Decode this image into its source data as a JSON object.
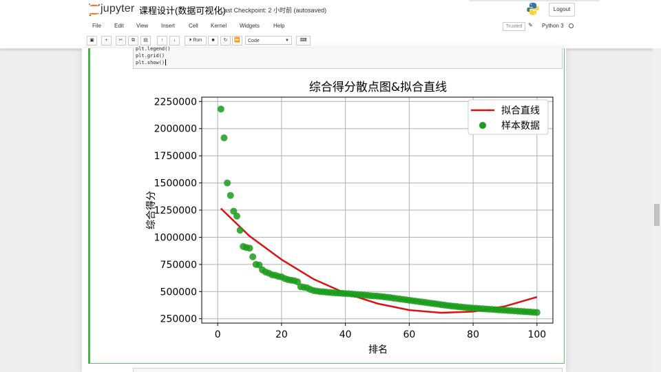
{
  "header": {
    "logo_text": "jupyter",
    "notebook_title": "课程设计(数据可视化)",
    "checkpoint": "Last Checkpoint: 2 小时前  (autosaved)",
    "logout_label": "Logout"
  },
  "menubar": {
    "items": [
      "File",
      "Edit",
      "View",
      "Insert",
      "Cell",
      "Kernel",
      "Widgets",
      "Help"
    ],
    "trusted_label": "Trusted",
    "kernel_name": "Python 3"
  },
  "toolbar": {
    "run_label": "Run",
    "cell_type": "Code"
  },
  "code": {
    "lines": [
      "plt.legend()",
      "plt.grid()",
      "plt.show()"
    ]
  },
  "colors": {
    "scatter": "#1a9b1a",
    "fit_line": "#dd1111",
    "cell_selected": "#66bb6a"
  },
  "chart_data": {
    "type": "scatter",
    "title": "综合得分散点图&拟合直线",
    "xlabel": "排名",
    "ylabel": "综合得分",
    "xlim": [
      -5,
      105
    ],
    "ylim": [
      210000,
      2290000
    ],
    "xticks": [
      0,
      20,
      40,
      60,
      80,
      100
    ],
    "yticks": [
      250000,
      500000,
      750000,
      1000000,
      1250000,
      1500000,
      1750000,
      2000000,
      2250000
    ],
    "grid": true,
    "legend_position": "top-right",
    "series": [
      {
        "name": "拟合直线",
        "kind": "line",
        "x": [
          1,
          10,
          20,
          30,
          40,
          50,
          60,
          70,
          80,
          90,
          100
        ],
        "y": [
          1265000,
          1010000,
          795000,
          615000,
          485000,
          390000,
          330000,
          305000,
          315000,
          365000,
          450000
        ]
      },
      {
        "name": "样本数据",
        "kind": "scatter",
        "x": [
          1,
          2,
          3,
          4,
          5,
          6,
          7,
          8,
          9,
          10,
          11,
          12,
          13,
          14,
          15,
          16,
          17,
          18,
          19,
          20,
          21,
          22,
          23,
          24,
          25,
          26,
          27,
          28,
          29,
          30,
          31,
          32,
          33,
          34,
          35,
          36,
          37,
          38,
          39,
          40,
          41,
          42,
          43,
          44,
          45,
          46,
          47,
          48,
          49,
          50,
          51,
          52,
          53,
          54,
          55,
          56,
          57,
          58,
          59,
          60,
          61,
          62,
          63,
          64,
          65,
          66,
          67,
          68,
          69,
          70,
          71,
          72,
          73,
          74,
          75,
          76,
          77,
          78,
          79,
          80,
          81,
          82,
          83,
          84,
          85,
          86,
          87,
          88,
          89,
          90,
          91,
          92,
          93,
          94,
          95,
          96,
          97,
          98,
          99,
          100
        ],
        "y": [
          2180000,
          1915000,
          1500000,
          1385000,
          1240000,
          1195000,
          1065000,
          915000,
          905000,
          900000,
          820000,
          750000,
          745000,
          700000,
          680000,
          670000,
          655000,
          650000,
          640000,
          635000,
          620000,
          610000,
          605000,
          600000,
          590000,
          545000,
          540000,
          535000,
          520000,
          510000,
          505000,
          500000,
          498000,
          495000,
          492000,
          490000,
          488000,
          486000,
          484000,
          482000,
          480000,
          478000,
          475000,
          472000,
          470000,
          468000,
          465000,
          462000,
          460000,
          458000,
          455000,
          452000,
          448000,
          445000,
          440000,
          436000,
          432000,
          428000,
          424000,
          420000,
          416000,
          412000,
          408000,
          404000,
          400000,
          396000,
          392000,
          388000,
          384000,
          380000,
          376000,
          372000,
          368000,
          365000,
          362000,
          359000,
          356000,
          353000,
          350000,
          348000,
          346000,
          344000,
          342000,
          340000,
          338000,
          336000,
          334000,
          332000,
          330000,
          328000,
          326000,
          324000,
          322000,
          320000,
          318000,
          316000,
          314000,
          312000,
          310000,
          308000
        ]
      }
    ]
  }
}
